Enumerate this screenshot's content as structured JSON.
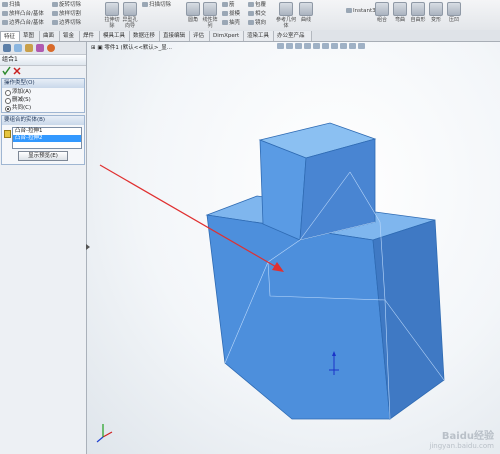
{
  "ribbon": {
    "left_group": [
      {
        "label": "扫描",
        "icon": "sweep-icon"
      },
      {
        "label": "放样凸台/基体",
        "icon": "loft-icon"
      },
      {
        "label": "边界凸台/基体",
        "icon": "boundary-boss-icon"
      }
    ],
    "cut_group": [
      {
        "label": "旋转切除",
        "icon": "revolve-cut-icon"
      },
      {
        "label": "放样切割",
        "icon": "loft-cut-icon"
      },
      {
        "label": "边界切除",
        "icon": "boundary-cut-icon"
      }
    ],
    "big_buttons": [
      {
        "label": "拉伸切除",
        "icon": "extrude-cut-icon"
      },
      {
        "label": "异型孔向导",
        "icon": "hole-wizard-icon"
      }
    ],
    "right_items": [
      {
        "label": "扫描切除",
        "icon": "sweep-cut-icon"
      },
      {
        "label": "圆角",
        "icon": "fillet-icon"
      },
      {
        "label": "线性阵列",
        "icon": "linear-pattern-icon"
      },
      {
        "label": "筋",
        "icon": "rib-icon"
      },
      {
        "label": "包覆",
        "icon": "wrap-icon"
      },
      {
        "label": "拔模",
        "icon": "draft-icon"
      },
      {
        "label": "相交",
        "icon": "intersect-icon"
      },
      {
        "label": "抽壳",
        "icon": "shell-icon"
      },
      {
        "label": "镜向",
        "icon": "mirror-icon"
      },
      {
        "label": "参考几何体",
        "icon": "reference-geometry-icon"
      },
      {
        "label": "曲线",
        "icon": "curves-icon"
      },
      {
        "label": "Instant3D",
        "icon": "instant3d-icon"
      },
      {
        "label": "组合",
        "icon": "combine-icon"
      },
      {
        "label": "弯曲",
        "icon": "flex-icon"
      },
      {
        "label": "自由形",
        "icon": "freeform-icon"
      },
      {
        "label": "变形",
        "icon": "deform-icon"
      },
      {
        "label": "压凹",
        "icon": "indent-icon"
      }
    ]
  },
  "tabs": [
    "特征",
    "草图",
    "曲面",
    "钣金",
    "焊件",
    "模具工具",
    "数据迁移",
    "直接编辑",
    "评估",
    "DimXpert",
    "渲染工具",
    "办公室产品"
  ],
  "panel": {
    "title": "组合1",
    "operation_type": {
      "header": "操作类型(O)",
      "options": [
        {
          "label": "添加(A)",
          "selected": false
        },
        {
          "label": "删减(S)",
          "selected": false
        },
        {
          "label": "共同(C)",
          "selected": true
        }
      ]
    },
    "bodies": {
      "header": "要组合的实体(B)",
      "items": [
        "凸台-拉伸1",
        "凸台-拉伸2"
      ],
      "show_preview_button": "显示预览(E)"
    }
  },
  "viewport": {
    "tree_label": "零件1 (默认<<默认>_显..."
  },
  "colors": {
    "accent": "#3399ff",
    "model_face": "#4a90e2",
    "arrow": "#e03030"
  },
  "watermark": {
    "text": "Baidu经验",
    "url": "jingyan.baidu.com"
  }
}
